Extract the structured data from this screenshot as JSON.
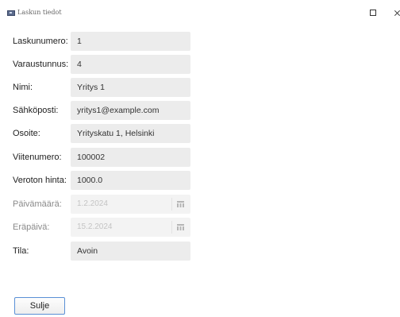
{
  "window": {
    "title": "Laskun tiedot"
  },
  "form": {
    "fields": [
      {
        "label": "Laskunumero:",
        "value": "1"
      },
      {
        "label": "Varaustunnus:",
        "value": "4"
      },
      {
        "label": "Nimi:",
        "value": "Yritys 1"
      },
      {
        "label": "Sähköposti:",
        "value": "yritys1@example.com"
      },
      {
        "label": "Osoite:",
        "value": "Yrityskatu 1, Helsinki"
      },
      {
        "label": "Viitenumero:",
        "value": "100002"
      },
      {
        "label": "Veroton hinta:",
        "value": "1000.0"
      }
    ],
    "paivamaara": {
      "label": "Päivämäärä:",
      "value": "1.2.2024"
    },
    "erapaiva": {
      "label": "Eräpäivä:",
      "value": "15.2.2024"
    },
    "tila": {
      "label": "Tila:",
      "value": "Avoin"
    }
  },
  "buttons": {
    "close_label": "Sulje"
  },
  "colors": {
    "field_bg": "#ececec",
    "disabled_field_bg": "#f3f3f3",
    "button_focus_border": "#5a90d6"
  }
}
